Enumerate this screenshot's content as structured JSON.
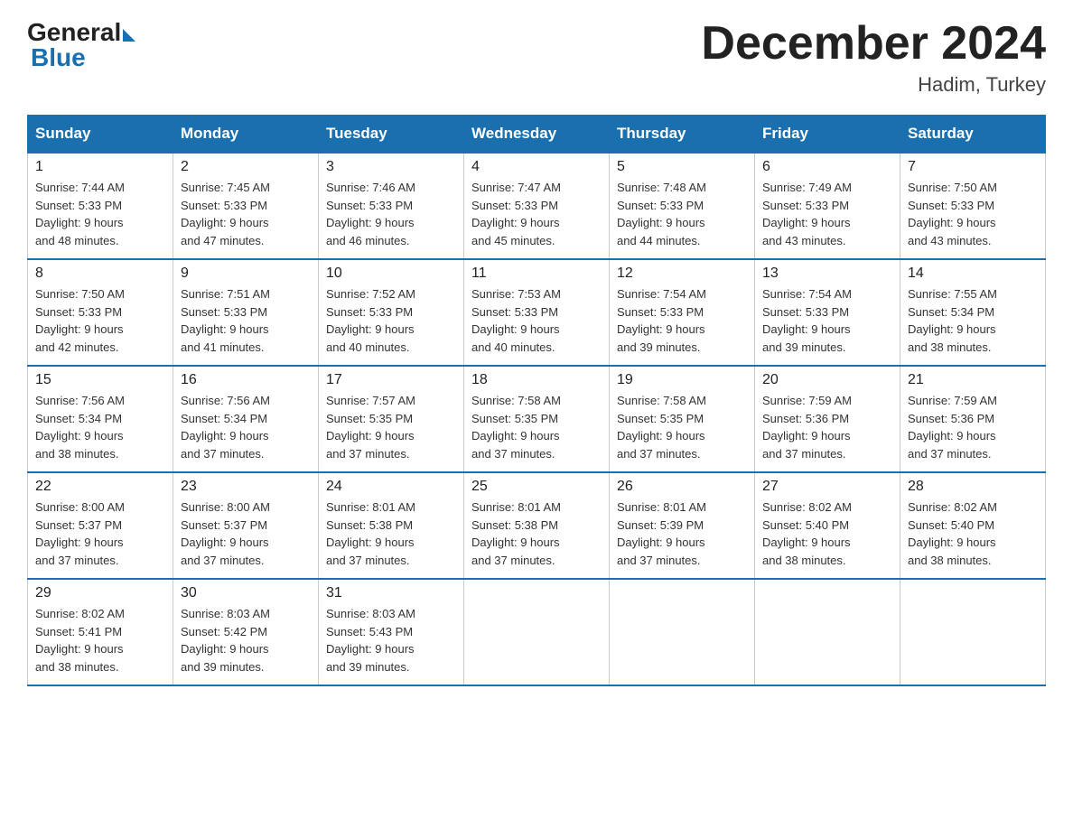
{
  "logo": {
    "general": "General",
    "blue": "Blue"
  },
  "title": "December 2024",
  "location": "Hadim, Turkey",
  "days_of_week": [
    "Sunday",
    "Monday",
    "Tuesday",
    "Wednesday",
    "Thursday",
    "Friday",
    "Saturday"
  ],
  "weeks": [
    [
      {
        "day": "1",
        "info": "Sunrise: 7:44 AM\nSunset: 5:33 PM\nDaylight: 9 hours\nand 48 minutes."
      },
      {
        "day": "2",
        "info": "Sunrise: 7:45 AM\nSunset: 5:33 PM\nDaylight: 9 hours\nand 47 minutes."
      },
      {
        "day": "3",
        "info": "Sunrise: 7:46 AM\nSunset: 5:33 PM\nDaylight: 9 hours\nand 46 minutes."
      },
      {
        "day": "4",
        "info": "Sunrise: 7:47 AM\nSunset: 5:33 PM\nDaylight: 9 hours\nand 45 minutes."
      },
      {
        "day": "5",
        "info": "Sunrise: 7:48 AM\nSunset: 5:33 PM\nDaylight: 9 hours\nand 44 minutes."
      },
      {
        "day": "6",
        "info": "Sunrise: 7:49 AM\nSunset: 5:33 PM\nDaylight: 9 hours\nand 43 minutes."
      },
      {
        "day": "7",
        "info": "Sunrise: 7:50 AM\nSunset: 5:33 PM\nDaylight: 9 hours\nand 43 minutes."
      }
    ],
    [
      {
        "day": "8",
        "info": "Sunrise: 7:50 AM\nSunset: 5:33 PM\nDaylight: 9 hours\nand 42 minutes."
      },
      {
        "day": "9",
        "info": "Sunrise: 7:51 AM\nSunset: 5:33 PM\nDaylight: 9 hours\nand 41 minutes."
      },
      {
        "day": "10",
        "info": "Sunrise: 7:52 AM\nSunset: 5:33 PM\nDaylight: 9 hours\nand 40 minutes."
      },
      {
        "day": "11",
        "info": "Sunrise: 7:53 AM\nSunset: 5:33 PM\nDaylight: 9 hours\nand 40 minutes."
      },
      {
        "day": "12",
        "info": "Sunrise: 7:54 AM\nSunset: 5:33 PM\nDaylight: 9 hours\nand 39 minutes."
      },
      {
        "day": "13",
        "info": "Sunrise: 7:54 AM\nSunset: 5:33 PM\nDaylight: 9 hours\nand 39 minutes."
      },
      {
        "day": "14",
        "info": "Sunrise: 7:55 AM\nSunset: 5:34 PM\nDaylight: 9 hours\nand 38 minutes."
      }
    ],
    [
      {
        "day": "15",
        "info": "Sunrise: 7:56 AM\nSunset: 5:34 PM\nDaylight: 9 hours\nand 38 minutes."
      },
      {
        "day": "16",
        "info": "Sunrise: 7:56 AM\nSunset: 5:34 PM\nDaylight: 9 hours\nand 37 minutes."
      },
      {
        "day": "17",
        "info": "Sunrise: 7:57 AM\nSunset: 5:35 PM\nDaylight: 9 hours\nand 37 minutes."
      },
      {
        "day": "18",
        "info": "Sunrise: 7:58 AM\nSunset: 5:35 PM\nDaylight: 9 hours\nand 37 minutes."
      },
      {
        "day": "19",
        "info": "Sunrise: 7:58 AM\nSunset: 5:35 PM\nDaylight: 9 hours\nand 37 minutes."
      },
      {
        "day": "20",
        "info": "Sunrise: 7:59 AM\nSunset: 5:36 PM\nDaylight: 9 hours\nand 37 minutes."
      },
      {
        "day": "21",
        "info": "Sunrise: 7:59 AM\nSunset: 5:36 PM\nDaylight: 9 hours\nand 37 minutes."
      }
    ],
    [
      {
        "day": "22",
        "info": "Sunrise: 8:00 AM\nSunset: 5:37 PM\nDaylight: 9 hours\nand 37 minutes."
      },
      {
        "day": "23",
        "info": "Sunrise: 8:00 AM\nSunset: 5:37 PM\nDaylight: 9 hours\nand 37 minutes."
      },
      {
        "day": "24",
        "info": "Sunrise: 8:01 AM\nSunset: 5:38 PM\nDaylight: 9 hours\nand 37 minutes."
      },
      {
        "day": "25",
        "info": "Sunrise: 8:01 AM\nSunset: 5:38 PM\nDaylight: 9 hours\nand 37 minutes."
      },
      {
        "day": "26",
        "info": "Sunrise: 8:01 AM\nSunset: 5:39 PM\nDaylight: 9 hours\nand 37 minutes."
      },
      {
        "day": "27",
        "info": "Sunrise: 8:02 AM\nSunset: 5:40 PM\nDaylight: 9 hours\nand 38 minutes."
      },
      {
        "day": "28",
        "info": "Sunrise: 8:02 AM\nSunset: 5:40 PM\nDaylight: 9 hours\nand 38 minutes."
      }
    ],
    [
      {
        "day": "29",
        "info": "Sunrise: 8:02 AM\nSunset: 5:41 PM\nDaylight: 9 hours\nand 38 minutes."
      },
      {
        "day": "30",
        "info": "Sunrise: 8:03 AM\nSunset: 5:42 PM\nDaylight: 9 hours\nand 39 minutes."
      },
      {
        "day": "31",
        "info": "Sunrise: 8:03 AM\nSunset: 5:43 PM\nDaylight: 9 hours\nand 39 minutes."
      },
      {
        "day": "",
        "info": ""
      },
      {
        "day": "",
        "info": ""
      },
      {
        "day": "",
        "info": ""
      },
      {
        "day": "",
        "info": ""
      }
    ]
  ]
}
